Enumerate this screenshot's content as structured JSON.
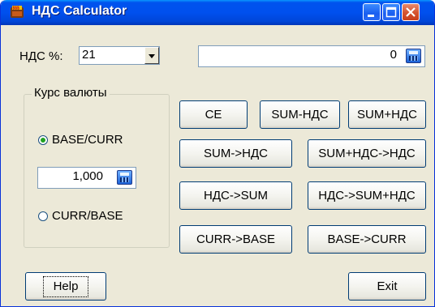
{
  "window": {
    "title": "НДС Calculator",
    "accent": "#0053ee"
  },
  "vat": {
    "label": "НДС %:",
    "selected": "21"
  },
  "amount": {
    "value": "0",
    "calc_icon": "calculator-icon"
  },
  "currency": {
    "group_title": "Курс валюты",
    "option_base_curr": "BASE/CURR",
    "option_curr_base": "CURR/BASE",
    "selected": "BASE/CURR",
    "rate": "1,000",
    "calc_icon": "calculator-icon"
  },
  "buttons": {
    "ce": "CE",
    "sum_minus_vat": "SUM-НДС",
    "sum_plus_vat": "SUM+НДС",
    "sum_to_vat": "SUM->НДС",
    "sum_plus_vat_to_vat": "SUM+НДС->НДС",
    "vat_to_sum": "НДС->SUM",
    "vat_to_sum_plus_vat": "НДС->SUM+НДС",
    "curr_to_base": "CURR->BASE",
    "base_to_curr": "BASE->CURR",
    "help": "Help",
    "exit": "Exit"
  }
}
